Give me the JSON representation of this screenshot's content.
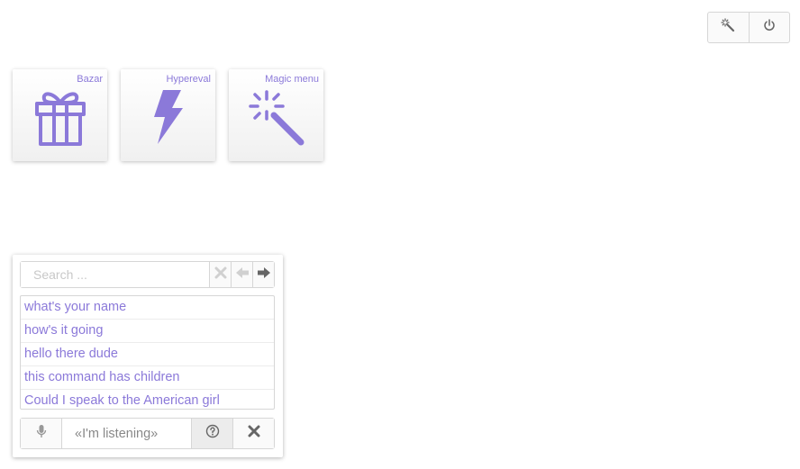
{
  "toolbar": {
    "magic_icon": "magic-wand-icon",
    "power_icon": "power-icon"
  },
  "tiles": [
    {
      "label": "Bazar",
      "icon": "gift-icon"
    },
    {
      "label": "Hypereval",
      "icon": "lightning-icon"
    },
    {
      "label": "Magic menu",
      "icon": "magic-wand-icon"
    }
  ],
  "colors": {
    "accent": "#8b79d9",
    "border": "#d6d6d6",
    "muted_icon": "#cfcfcf",
    "dark_icon": "#666666"
  },
  "search": {
    "placeholder": "Search ..."
  },
  "commands": [
    "what's your name",
    "how's it going",
    "hello there dude",
    "this command has children",
    "Could I speak to the American girl"
  ],
  "voice": {
    "status_text": "«I'm listening»"
  }
}
